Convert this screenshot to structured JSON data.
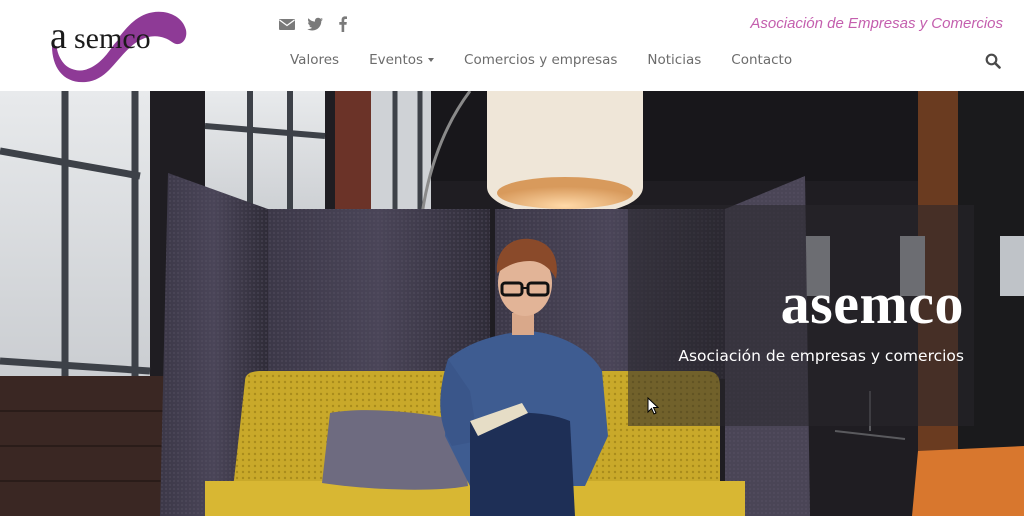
{
  "brand": {
    "logo_text": "asemco",
    "tagline": "Asociación de Empresas y Comercios",
    "accent_color": "#8e3a96",
    "tagline_color": "#c45fae"
  },
  "social": [
    {
      "icon": "envelope-icon"
    },
    {
      "icon": "twitter-icon"
    },
    {
      "icon": "facebook-icon"
    }
  ],
  "nav": {
    "items": [
      {
        "label": "Valores"
      },
      {
        "label": "Eventos",
        "has_dropdown": true
      },
      {
        "label": "Comercios y empresas"
      },
      {
        "label": "Noticias"
      },
      {
        "label": "Contacto"
      }
    ],
    "search_icon": "search-icon"
  },
  "hero": {
    "title": "asemco",
    "subtitle": "Asociación de empresas y comercios"
  }
}
